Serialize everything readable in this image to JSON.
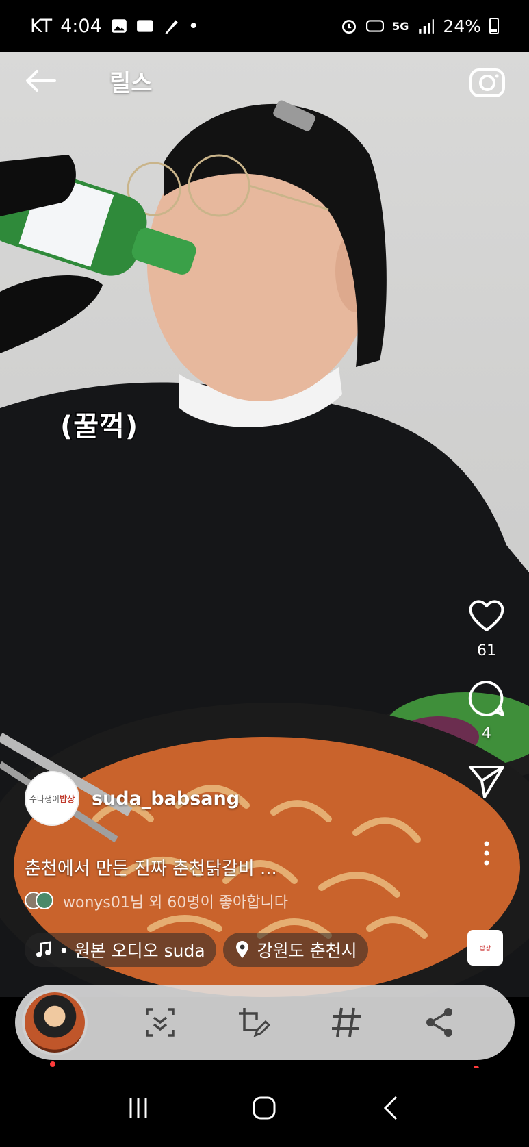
{
  "status_bar": {
    "carrier": "KT",
    "time": "4:04",
    "battery": "24%",
    "network": "5G"
  },
  "header": {
    "title": "릴스"
  },
  "video": {
    "caption_sticker": "(꿀꺽)"
  },
  "actions": {
    "likes_count": "61",
    "comments_count": "4"
  },
  "post": {
    "username": "suda_babsang",
    "avatar_text": "수다쟁이",
    "avatar_accent": "밥상",
    "description": "춘천에서 만든 진짜 춘천닭갈비 ...",
    "liked_by": "wonys01님 외 60명이 좋아합니다"
  },
  "tags": {
    "audio": "• 원본 오디오   suda",
    "location": "강원도 춘천시"
  },
  "icons": {
    "back": "arrow-left-icon",
    "camera": "camera-icon",
    "like": "heart-icon",
    "comment": "speech-bubble-icon",
    "share": "paper-plane-icon",
    "more": "vertical-dots-icon",
    "music": "music-note-icon",
    "location": "map-pin-icon"
  },
  "colors": {
    "accent_red": "#ff3b3b",
    "status_bg": "#000000"
  }
}
